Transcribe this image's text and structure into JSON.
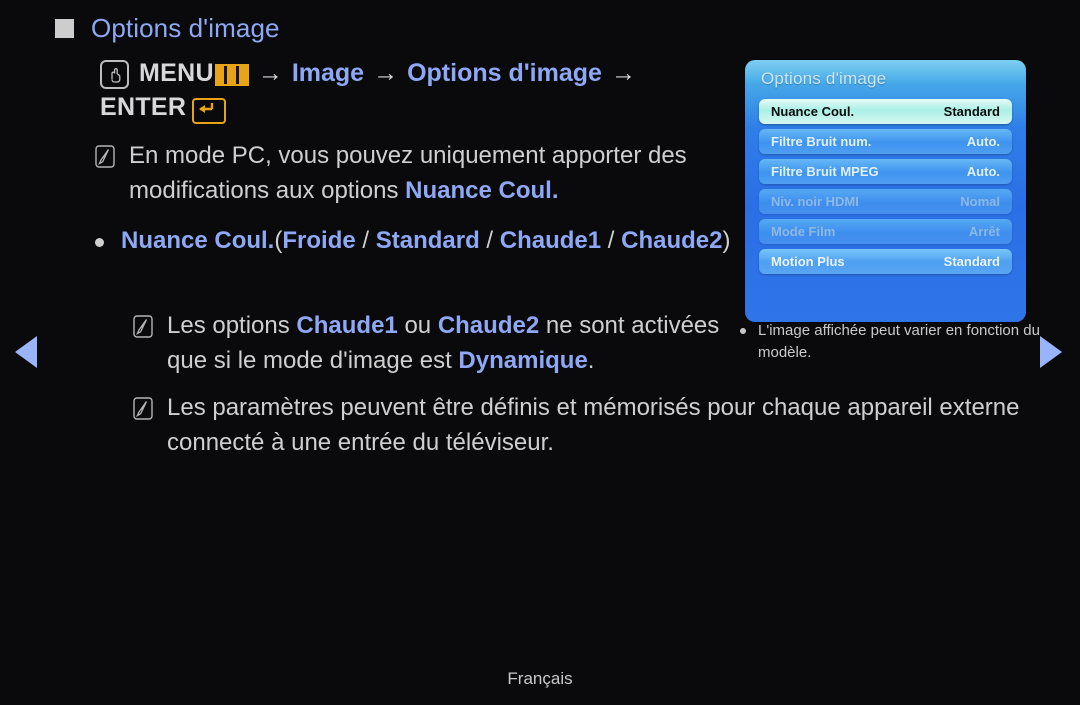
{
  "page": {
    "heading": "Options d'image",
    "language_footer": "Français"
  },
  "menu_path": {
    "remote_icon": "hand-press-icon",
    "menu_label": "MENU",
    "menu_glyph": "menu-grid-icon",
    "arrow": "→",
    "step2": "Image",
    "step3": "Options d'image",
    "enter_label": "ENTER",
    "enter_glyph": "enter-arrow-icon"
  },
  "notes": [
    {
      "icon": "note-pen-icon",
      "segments": [
        {
          "text": "En mode PC, vous pouvez uniquement apporter des modifications aux options ",
          "style": "plain"
        },
        {
          "text": "Nuance Coul.",
          "style": "blue-bold"
        }
      ]
    },
    {
      "icon": "note-pen-icon",
      "segments": [
        {
          "text": "Les options ",
          "style": "plain"
        },
        {
          "text": "Chaude1",
          "style": "blue-bold"
        },
        {
          "text": " ou ",
          "style": "plain"
        },
        {
          "text": "Chaude2",
          "style": "blue-bold"
        },
        {
          "text": " ne sont activées que si le mode d'image est ",
          "style": "plain"
        },
        {
          "text": "Dynamique",
          "style": "blue-bold"
        },
        {
          "text": ".",
          "style": "plain"
        }
      ]
    },
    {
      "icon": "note-pen-icon",
      "segments": [
        {
          "text": "Les paramètres peuvent être définis et mémorisés pour chaque appareil externe connecté à une entrée du téléviseur.",
          "style": "plain"
        }
      ]
    }
  ],
  "option_bullet": {
    "bullet": "round-bullet",
    "name": "Nuance Coul.",
    "open_paren": "(",
    "values": [
      "Froide",
      "Standard",
      "Chaude1",
      "Chaude2"
    ],
    "separator": " / ",
    "close_paren": ")"
  },
  "osd": {
    "title": "Options d'image",
    "rows": [
      {
        "label": "Nuance Coul.",
        "value": "Standard",
        "state": "sel"
      },
      {
        "label": "Filtre Bruit num.",
        "value": "Auto.",
        "state": "norm"
      },
      {
        "label": "Filtre Bruit MPEG",
        "value": "Auto.",
        "state": "norm"
      },
      {
        "label": "Niv. noir HDMI",
        "value": "Nomal",
        "state": "dim"
      },
      {
        "label": "Mode Film",
        "value": "Arrêt",
        "state": "dim"
      },
      {
        "label": "Motion Plus",
        "value": "Standard",
        "state": "bright"
      }
    ],
    "caption": "L'image affichée peut varier en fonction du modèle."
  },
  "nav": {
    "prev": "previous-page-arrow",
    "next": "next-page-arrow"
  },
  "colors": {
    "background": "#0a0a0c",
    "accent_blue": "#8fa8f5",
    "body_text": "#cfcfcf",
    "highlight_yellow": "#e8a417",
    "osd_blue": "#2b6fe6"
  }
}
